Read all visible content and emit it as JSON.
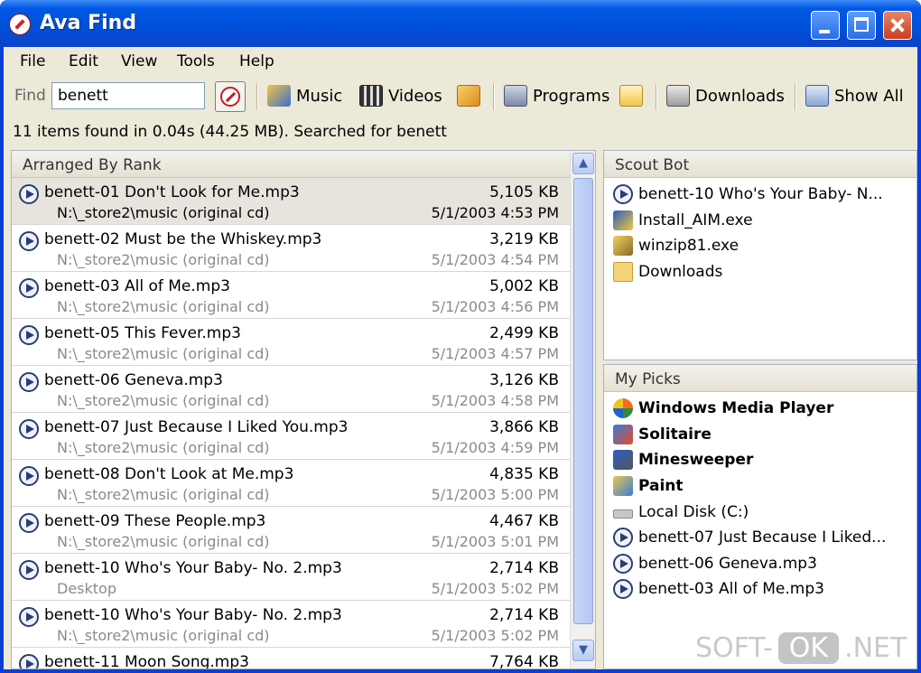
{
  "window": {
    "title": "Ava Find"
  },
  "menu": [
    "File",
    "Edit",
    "View",
    "Tools",
    "Help"
  ],
  "toolbar": {
    "find_label": "Find",
    "search_value": "benett",
    "buttons": [
      {
        "label": "Music",
        "icon": "music-icon"
      },
      {
        "label": "Videos",
        "icon": "videos-icon"
      },
      {
        "label": "",
        "icon": "images-icon"
      },
      {
        "label": "Programs",
        "icon": "programs-icon"
      },
      {
        "label": "",
        "icon": "documents-icon"
      },
      {
        "label": "Downloads",
        "icon": "downloads-icon"
      },
      {
        "label": "Show All",
        "icon": "show-all-icon"
      }
    ]
  },
  "status": "11 items found in 0.04s (44.25 MB).  Searched for benett",
  "results": {
    "header": "Arranged By Rank",
    "rows": [
      {
        "name": "benett-01 Don't Look for Me.mp3",
        "size": "5,105 KB",
        "path": "N:\\_store2\\music (original cd)",
        "date": "5/1/2003 4:53 PM",
        "selected": true
      },
      {
        "name": "benett-02 Must be the Whiskey.mp3",
        "size": "3,219 KB",
        "path": "N:\\_store2\\music (original cd)",
        "date": "5/1/2003 4:54 PM"
      },
      {
        "name": "benett-03 All of Me.mp3",
        "size": "5,002 KB",
        "path": "N:\\_store2\\music (original cd)",
        "date": "5/1/2003 4:56 PM"
      },
      {
        "name": "benett-05 This Fever.mp3",
        "size": "2,499 KB",
        "path": "N:\\_store2\\music (original cd)",
        "date": "5/1/2003 4:57 PM"
      },
      {
        "name": "benett-06 Geneva.mp3",
        "size": "3,126 KB",
        "path": "N:\\_store2\\music (original cd)",
        "date": "5/1/2003 4:58 PM"
      },
      {
        "name": "benett-07 Just Because I Liked You.mp3",
        "size": "3,866 KB",
        "path": "N:\\_store2\\music (original cd)",
        "date": "5/1/2003 4:59 PM"
      },
      {
        "name": "benett-08 Don't Look at Me.mp3",
        "size": "4,835 KB",
        "path": "N:\\_store2\\music (original cd)",
        "date": "5/1/2003 5:00 PM"
      },
      {
        "name": "benett-09 These People.mp3",
        "size": "4,467 KB",
        "path": "N:\\_store2\\music (original cd)",
        "date": "5/1/2003 5:01 PM"
      },
      {
        "name": "benett-10 Who's Your Baby- No. 2.mp3",
        "size": "2,714 KB",
        "path": "Desktop",
        "date": "5/1/2003 5:02 PM"
      },
      {
        "name": "benett-10 Who's Your Baby- No. 2.mp3",
        "size": "2,714 KB",
        "path": "N:\\_store2\\music (original cd)",
        "date": "5/1/2003 5:02 PM"
      },
      {
        "name": "benett-11 Moon Song.mp3",
        "size": "7,764 KB",
        "path": "",
        "date": ""
      }
    ]
  },
  "scout_bot": {
    "header": "Scout Bot",
    "items": [
      {
        "label": "benett-10 Who's Your Baby- N...",
        "icon": "media-file-icon"
      },
      {
        "label": "Install_AIM.exe",
        "icon": "installer-icon"
      },
      {
        "label": "winzip81.exe",
        "icon": "winzip-icon"
      },
      {
        "label": "Downloads",
        "icon": "folder-icon"
      }
    ]
  },
  "my_picks": {
    "header": "My Picks",
    "items": [
      {
        "label": "Windows Media Player",
        "icon": "windows-media-player-icon",
        "bold": true
      },
      {
        "label": "Solitaire",
        "icon": "solitaire-icon",
        "bold": true
      },
      {
        "label": "Minesweeper",
        "icon": "minesweeper-icon",
        "bold": true
      },
      {
        "label": "Paint",
        "icon": "paint-icon",
        "bold": true
      },
      {
        "label": "Local Disk (C:)",
        "icon": "local-disk-icon",
        "bold": false
      },
      {
        "label": "benett-07 Just Because I Liked...",
        "icon": "media-file-icon",
        "bold": false
      },
      {
        "label": "benett-06 Geneva.mp3",
        "icon": "media-file-icon",
        "bold": false
      },
      {
        "label": "benett-03 All of Me.mp3",
        "icon": "media-file-icon",
        "bold": false
      }
    ]
  },
  "watermark": {
    "left": "SOFT-",
    "mid": "OK",
    "right": ".NET"
  }
}
